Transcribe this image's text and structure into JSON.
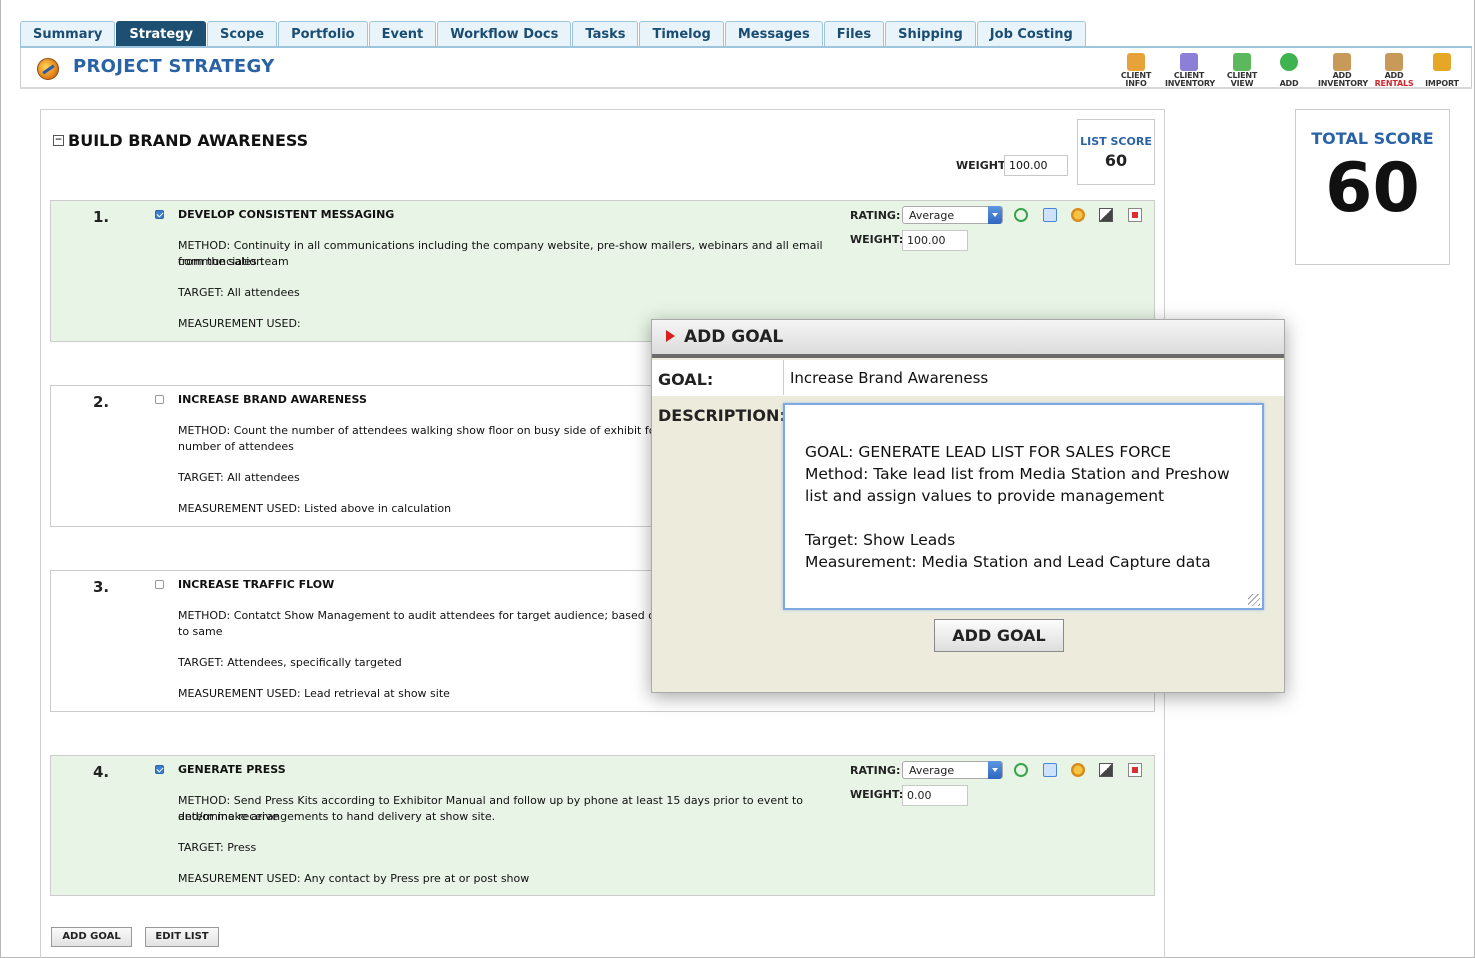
{
  "tabs": [
    "Summary",
    "Strategy",
    "Scope",
    "Portfolio",
    "Event",
    "Workflow Docs",
    "Tasks",
    "Timelog",
    "Messages",
    "Files",
    "Shipping",
    "Job Costing"
  ],
  "active_tab": "Strategy",
  "page_title": "PROJECT STRATEGY",
  "toolbar": [
    {
      "l1": "CLIENT",
      "l2": "INFO",
      "icon": "person-icon",
      "color": "#e8a23a"
    },
    {
      "l1": "CLIENT",
      "l2": "INVENTORY",
      "icon": "box-icon",
      "color": "#8c7fd6"
    },
    {
      "l1": "CLIENT",
      "l2": "VIEW",
      "icon": "arrows-icon",
      "color": "#5cb85c"
    },
    {
      "l1": "",
      "l2": "ADD",
      "icon": "plus-circle-icon",
      "color": "#3fb34f"
    },
    {
      "l1": "ADD",
      "l2": "INVENTORY",
      "icon": "package-add-icon",
      "color": "#c79a5a"
    },
    {
      "l1": "ADD",
      "l2": "RENTALS",
      "icon": "package-rent-icon",
      "color": "#c79a5a",
      "l2color": "#d0282e"
    },
    {
      "l1": "",
      "l2": "IMPORT",
      "icon": "import-icon",
      "color": "#e7a726"
    }
  ],
  "list": {
    "title": "BUILD BRAND AWARENESS",
    "weight_label": "WEIGHT:",
    "weight_value": "100.00",
    "score_label": "LIST SCORE",
    "score_value": "60"
  },
  "total": {
    "label": "TOTAL SCORE",
    "value": "60"
  },
  "goals": [
    {
      "num": "1.",
      "checked": true,
      "title": "DEVELOP CONSISTENT MESSAGING",
      "method": [
        "METHOD: Continuity in all communications including the company website, pre-show mailers, webinars and all email communciation",
        "from the sales team"
      ],
      "target": "TARGET: All attendees",
      "measurement": "MEASUREMENT USED:",
      "rating_label": "RATING:",
      "rating": "Average",
      "weight_label": "WEIGHT:",
      "weight": "100.00"
    },
    {
      "num": "2.",
      "checked": false,
      "title": "INCREASE BRAND AWARENESS",
      "method": [
        "METHOD: Count the number of attendees walking show floor on busy side of exhibit for 5 minu",
        "number of attendees"
      ],
      "target": "TARGET: All attendees",
      "measurement": "MEASUREMENT USED: Listed above in calculation"
    },
    {
      "num": "3.",
      "checked": false,
      "title": "INCREASE TRAFFIC FLOW",
      "method": [
        "METHOD: Contatct Show Management to audit attendees for target audience; based on respon",
        "to same"
      ],
      "target": "TARGET: Attendees, specifically targeted",
      "measurement": "MEASUREMENT USED: Lead retrieval at show site"
    },
    {
      "num": "4.",
      "checked": true,
      "title": "GENERATE PRESS",
      "method": [
        "METHOD: Send Press Kits according to Exhibitor Manual and follow up by phone at least 15 days prior to event to determine receive",
        "and/or make arrangements to hand delivery at show site."
      ],
      "target": "TARGET: Press",
      "measurement": "MEASUREMENT USED: Any contact by Press pre at or post show",
      "rating_label": "RATING:",
      "rating": "Average",
      "weight_label": "WEIGHT:",
      "weight": "0.00"
    }
  ],
  "buttons": {
    "add_goal": "ADD GOAL",
    "edit_list": "EDIT LIST"
  },
  "modal": {
    "title": "ADD GOAL",
    "goal_label": "GOAL:",
    "goal_value": "Increase Brand Awareness",
    "desc_label": "DESCRIPTION:",
    "desc_lines": [
      "GOAL: GENERATE LEAD LIST FOR SALES FORCE",
      "Method: Take lead list from Media Station and Preshow",
      "list and assign values to provide management",
      "",
      "Target: Show Leads",
      "Measurement: Media Station and Lead Capture data"
    ],
    "submit": "ADD GOAL"
  }
}
